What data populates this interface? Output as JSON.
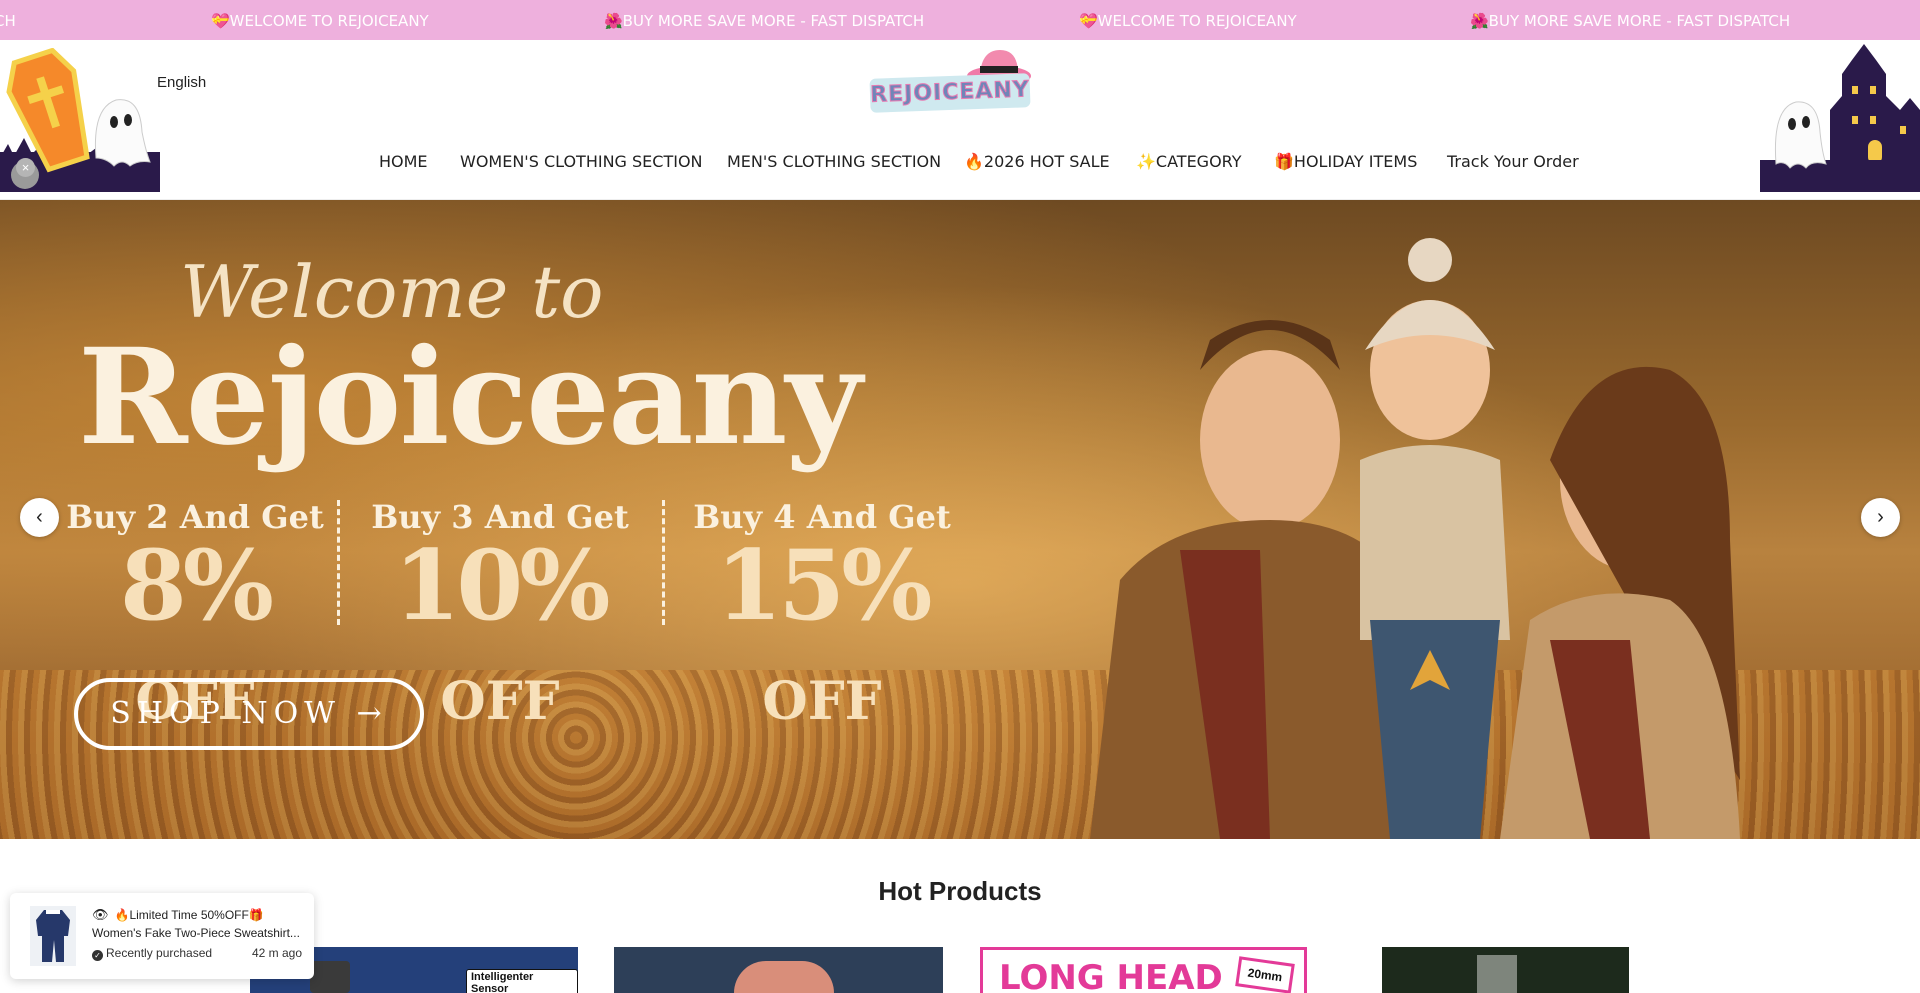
{
  "announcement": {
    "items": [
      "CH",
      "💝WELCOME TO REJOICEANY",
      "🌺BUY MORE SAVE MORE - FAST DISPATCH",
      "💝WELCOME TO REJOICEANY",
      "🌺BUY MORE SAVE MORE - FAST DISPATCH"
    ]
  },
  "header": {
    "language": "English",
    "logo_text": "REJOICEANY",
    "close_icon": "×"
  },
  "nav": {
    "items": [
      "HOME",
      "WOMEN'S CLOTHING SECTION",
      "MEN'S CLOTHING SECTION",
      "🔥2026 HOT SALE",
      "✨CATEGORY",
      "🎁HOLIDAY ITEMS",
      "Track Your Order"
    ]
  },
  "hero": {
    "welcome": "Welcome to",
    "brand": "Rejoiceany",
    "offers": [
      {
        "line1": "Buy 2 And Get",
        "pct": "8%",
        "off": "OFF"
      },
      {
        "line1": "Buy 3 And Get",
        "pct": "10%",
        "off": "OFF"
      },
      {
        "line1": "Buy 4 And Get",
        "pct": "15%",
        "off": "OFF"
      }
    ],
    "cta": "SHOP NOW →",
    "prev_icon": "‹",
    "next_icon": "›"
  },
  "products_section": {
    "title": "Hot Products",
    "card_labels": [
      "Intelligenter Sensor",
      "LONG HEAD",
      "20mm"
    ]
  },
  "purchase_popup": {
    "headline": "🔥Limited Time 50%OFF🎁",
    "product": "Women's Fake Two-Piece Sweatshirt...",
    "status": "Recently purchased",
    "time": "42 m ago"
  },
  "colors": {
    "announcement_bg": "#eeb0dd",
    "text": "#222222"
  }
}
